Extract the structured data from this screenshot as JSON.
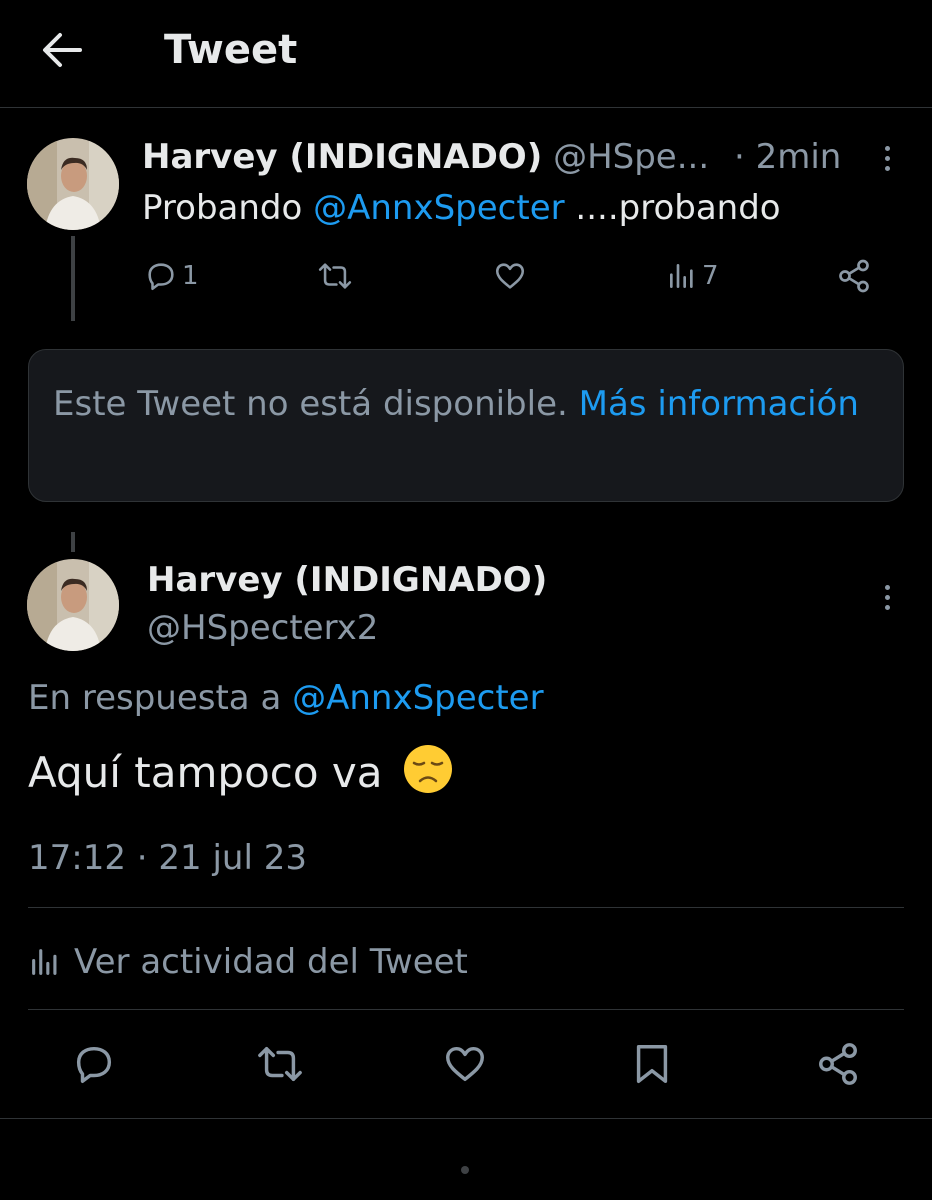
{
  "header": {
    "title": "Tweet",
    "back_icon": "arrow-left-icon"
  },
  "tweet1": {
    "author_name": "Harvey (INDIGNADO)",
    "handle_truncated": "@HSpe...",
    "time": "· 2min",
    "text_prefix": "Probando ",
    "mention": "@AnnxSpecter",
    "text_suffix": " ....probando",
    "replies": "1",
    "views": "7",
    "icons": [
      "reply-icon",
      "retweet-icon",
      "like-icon",
      "views-icon",
      "share-icon",
      "more-icon"
    ]
  },
  "unavailable": {
    "text": "Este Tweet no está disponible. ",
    "link": "Más información"
  },
  "tweet2": {
    "author_name": "Harvey (INDIGNADO)",
    "handle": "@HSpecterx2",
    "reply_prefix": "En respuesta a ",
    "reply_mention": "@AnnxSpecter",
    "text": "Aquí tampoco va",
    "emoji": "disappointed-face-emoji",
    "timestamp": "17:12 · 21 jul 23",
    "activity": "Ver actividad del Tweet",
    "icons": [
      "reply-icon",
      "retweet-icon",
      "like-icon",
      "bookmark-icon",
      "share-icon"
    ]
  },
  "colors": {
    "background": "#000000",
    "text": "#e7e9ea",
    "muted": "#8b98a5",
    "link": "#1d9bf0",
    "border": "#2f3336",
    "card": "#16181c"
  }
}
